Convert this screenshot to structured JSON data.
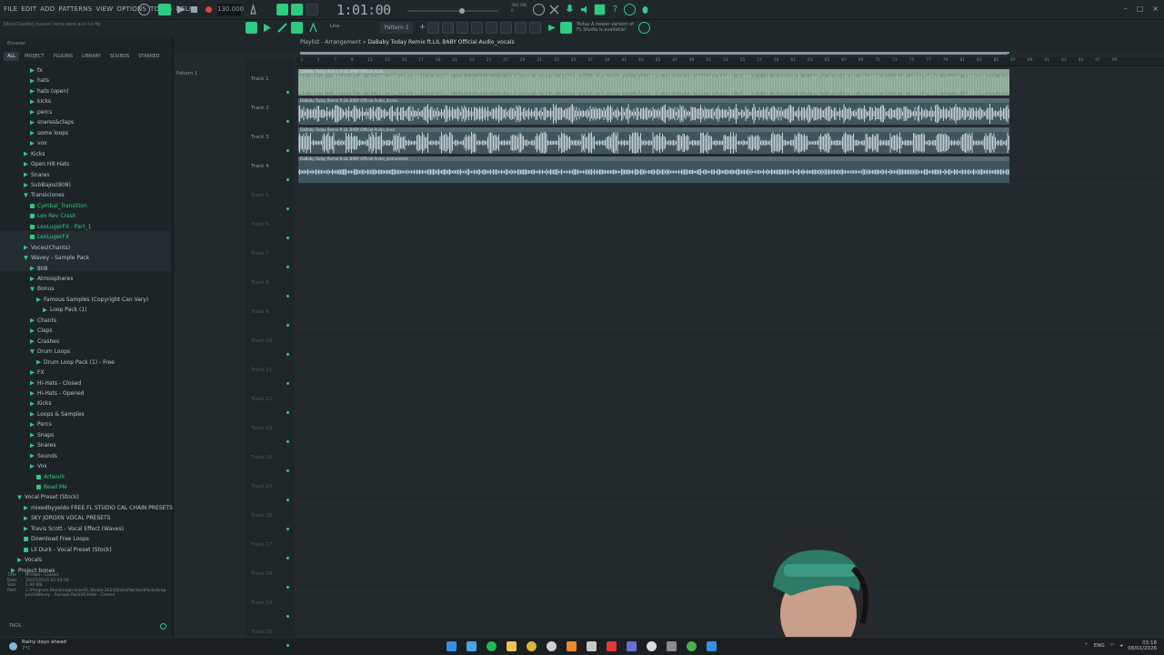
{
  "menubar": {
    "items": [
      "FILE",
      "EDIT",
      "ADD",
      "PATTERNS",
      "VIEW",
      "OPTIONS",
      "TOOLS",
      "HELP"
    ],
    "hint": "[AlexClaudio] nuevo! tema pero aun no flp",
    "tempo": "130.000",
    "clock": "1:01:00",
    "cpu": "380 MB\n0",
    "pattern": "Pattern 1",
    "snap": "Line",
    "notice_line1": "Today  A newer version of",
    "notice_line2": "FL Studio is available!"
  },
  "browser": {
    "title": "Browser",
    "tabs": [
      "ALL",
      "PROJECT",
      "PLUGINS",
      "LIBRARY",
      "SOUNDS",
      "STARRED"
    ],
    "active_tab": "ALL",
    "items": [
      {
        "label": "fx",
        "indent": 3
      },
      {
        "label": "hats",
        "indent": 3
      },
      {
        "label": "hats (open)",
        "indent": 3
      },
      {
        "label": "kicks",
        "indent": 3
      },
      {
        "label": "percs",
        "indent": 3
      },
      {
        "label": "snares&claps",
        "indent": 3
      },
      {
        "label": "some loops",
        "indent": 3
      },
      {
        "label": "vox",
        "indent": 3
      },
      {
        "label": "Kicks",
        "indent": 2
      },
      {
        "label": "Open Hit-Hats",
        "indent": 2
      },
      {
        "label": "Snares",
        "indent": 2
      },
      {
        "label": "SubBajos(808)",
        "indent": 2
      },
      {
        "label": "Transiciones",
        "indent": 2,
        "open": true
      },
      {
        "label": "Cymbal_Transition",
        "indent": 3,
        "file": true,
        "sel": true
      },
      {
        "label": "Lex Rev Crash",
        "indent": 3,
        "file": true,
        "sel": true
      },
      {
        "label": "LexLugerFX - Part_1",
        "indent": 3,
        "file": true,
        "sel": true
      },
      {
        "label": "LexLugerFX",
        "indent": 3,
        "file": true,
        "sel": true
      },
      {
        "label": "Voces(Chants)",
        "indent": 2
      },
      {
        "label": "Wavey - Sample Pack",
        "indent": 2,
        "open": true
      },
      {
        "label": "808",
        "indent": 3
      },
      {
        "label": "Atmospheres",
        "indent": 3
      },
      {
        "label": "Bonus",
        "indent": 3,
        "open": true
      },
      {
        "label": "Famous Samples (Copyright Can Vary)",
        "indent": 4
      },
      {
        "label": "Loop Pack (1)",
        "indent": 5
      },
      {
        "label": "Chants",
        "indent": 3
      },
      {
        "label": "Claps",
        "indent": 3
      },
      {
        "label": "Crashes",
        "indent": 3
      },
      {
        "label": "Drum Loops",
        "indent": 3,
        "open": true
      },
      {
        "label": "Drum Loop Pack (1) - Free",
        "indent": 4
      },
      {
        "label": "FX",
        "indent": 3
      },
      {
        "label": "Hi-Hats - Closed",
        "indent": 3
      },
      {
        "label": "Hi-Hats - Opened",
        "indent": 3
      },
      {
        "label": "Kicks",
        "indent": 3
      },
      {
        "label": "Loops & Samples",
        "indent": 3
      },
      {
        "label": "Percs",
        "indent": 3
      },
      {
        "label": "Snaps",
        "indent": 3
      },
      {
        "label": "Snares",
        "indent": 3
      },
      {
        "label": "Sounds",
        "indent": 3
      },
      {
        "label": "Vox",
        "indent": 3
      },
      {
        "label": "Artwork",
        "indent": 4,
        "file": true,
        "sel": true
      },
      {
        "label": "Read Me",
        "indent": 4,
        "file": true,
        "sel": true
      },
      {
        "label": "Vocal Preset (Stock)",
        "indent": 1,
        "open": true
      },
      {
        "label": "mixedbyyeldo FREE FL STUDIO CAL CHAIN PRESETS VOL. 2",
        "indent": 2
      },
      {
        "label": "SKY JOROXN VOCAL PRESETS",
        "indent": 2
      },
      {
        "label": "Travis Scott - Vocal Effect (Waves)",
        "indent": 2
      },
      {
        "label": "Download Free Loops",
        "indent": 2,
        "file": true
      },
      {
        "label": "Lil Durk - Vocal Preset (Stock)",
        "indent": 2,
        "file": true
      },
      {
        "label": "Vocals",
        "indent": 1
      },
      {
        "label": "Project bones",
        "indent": 0
      }
    ],
    "info": {
      "title_label": "Title",
      "title": "Hi-Hats - Closed",
      "date_label": "Date",
      "date": "26/07/2024 05:44:56",
      "size_label": "Size",
      "size": "1.94 MB",
      "path_label": "Path",
      "path": "C:\\Program Files\\Image-Line\\FL Studio 2024\\Data\\Patches\\Packs\\trap pack\\Wavey - Sample Pack\\Hi-Hats - Closed"
    },
    "tags_label": "TAGS"
  },
  "playlist": {
    "title_prefix": "Playlist - Arrangement",
    "title_song": "DaBaby Today Remix ft.LIL BABY Official Audio_vocals",
    "pattern_label": "Pattern 1",
    "ruler_numbers": [
      "3",
      "5",
      "7",
      "9",
      "11",
      "13",
      "15",
      "17",
      "19",
      "21",
      "23",
      "25",
      "27",
      "29",
      "31",
      "33",
      "35",
      "37",
      "39",
      "41",
      "43",
      "45",
      "47",
      "49",
      "51",
      "53",
      "55",
      "57",
      "59",
      "61",
      "63",
      "65",
      "67",
      "69",
      "71",
      "73",
      "75",
      "77",
      "79",
      "81",
      "83",
      "85",
      "87",
      "89",
      "91",
      "93",
      "95",
      "97",
      "99"
    ],
    "tracks": [
      {
        "label": "Track 1",
        "clip": "DaBaby Today Remix ft.LIL BABY Official Audio",
        "color": "#7e9a88",
        "wave": "#9cb7a4",
        "style": "dense"
      },
      {
        "label": "Track 2",
        "clip": "DaBaby Today Remix ft.LIL BABY Official Audio_drums",
        "color": "#3f5660",
        "wave": "#c5d1d5",
        "style": "drums"
      },
      {
        "label": "Track 3",
        "clip": "DaBaby Today Remix ft.LIL BABY Official Audio_bass",
        "color": "#3f5660",
        "wave": "#c5d1d5",
        "style": "bass"
      },
      {
        "label": "Track 4",
        "clip": "DaBaby Today Remix ft.LIL BABY Official Audio_instruments",
        "color": "#3f5660",
        "wave": "#c5d1d5",
        "style": "thin"
      },
      {
        "label": "Track 5"
      },
      {
        "label": "Track 6"
      },
      {
        "label": "Track 7"
      },
      {
        "label": "Track 8"
      },
      {
        "label": "Track 9"
      },
      {
        "label": "Track 10"
      },
      {
        "label": "Track 11"
      },
      {
        "label": "Track 12"
      },
      {
        "label": "Track 13"
      },
      {
        "label": "Track 14"
      },
      {
        "label": "Track 15"
      },
      {
        "label": "Track 16"
      },
      {
        "label": "Track 17"
      },
      {
        "label": "Track 18"
      },
      {
        "label": "Track 19"
      },
      {
        "label": "Track 20"
      }
    ]
  },
  "taskbar": {
    "weather_line1": "Rainy days ahead",
    "weather_line2": "7°C",
    "lang": "ENG",
    "time": "03:18",
    "date": "08/01/2026"
  },
  "colors": {
    "accent": "#2ecb84",
    "bg": "#222a2d"
  }
}
